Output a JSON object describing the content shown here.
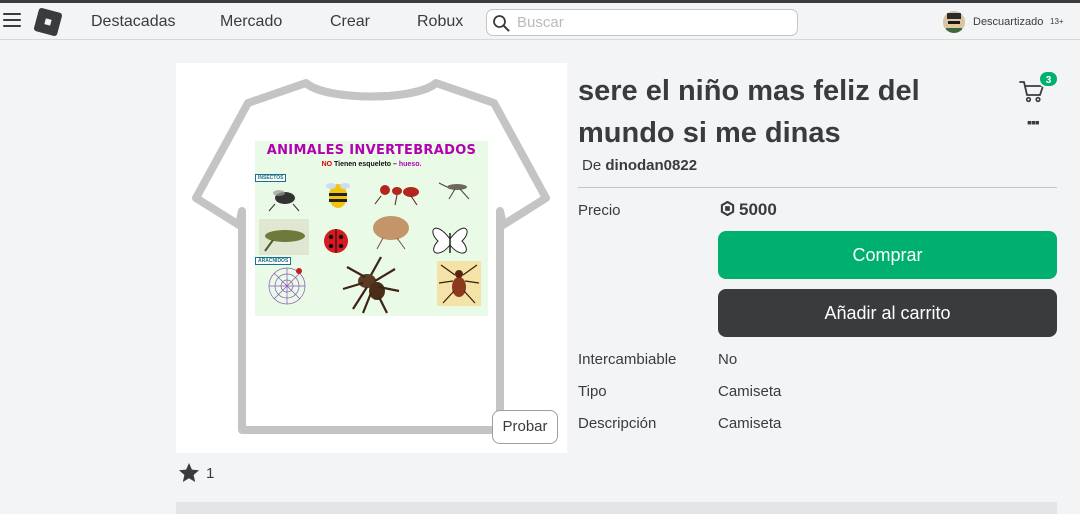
{
  "header": {
    "nav": [
      "Destacadas",
      "Mercado",
      "Crear",
      "Robux"
    ],
    "search_placeholder": "Buscar",
    "username": "Descuartizado",
    "age_badge": "13+"
  },
  "item": {
    "title": "sere el niño mas feliz del mundo si me dinas",
    "creator_prefix": "De",
    "creator": "dinodan0822",
    "price_label": "Precio",
    "price": "5000",
    "buy_label": "Comprar",
    "add_to_cart_label": "Añadir al carrito",
    "try_on_label": "Probar",
    "favorites": "1",
    "cart_count": "3",
    "details": [
      {
        "label": "Intercambiable",
        "value": "No"
      },
      {
        "label": "Tipo",
        "value": "Camiseta"
      },
      {
        "label": "Descripción",
        "value": "Camiseta"
      }
    ]
  },
  "decal": {
    "title": "ANIMALES INVERTEBRADOS",
    "subtitle_neg": "NO",
    "subtitle_mid": "Tienen esqueleto –",
    "subtitle_end": "hueso.",
    "tag_insects": "INSECTOS",
    "tag_arachnids": "ARÁCNIDOS"
  },
  "colors": {
    "accent": "#00b06f",
    "dark_button": "#393b3d",
    "background": "#f2f4f5"
  }
}
